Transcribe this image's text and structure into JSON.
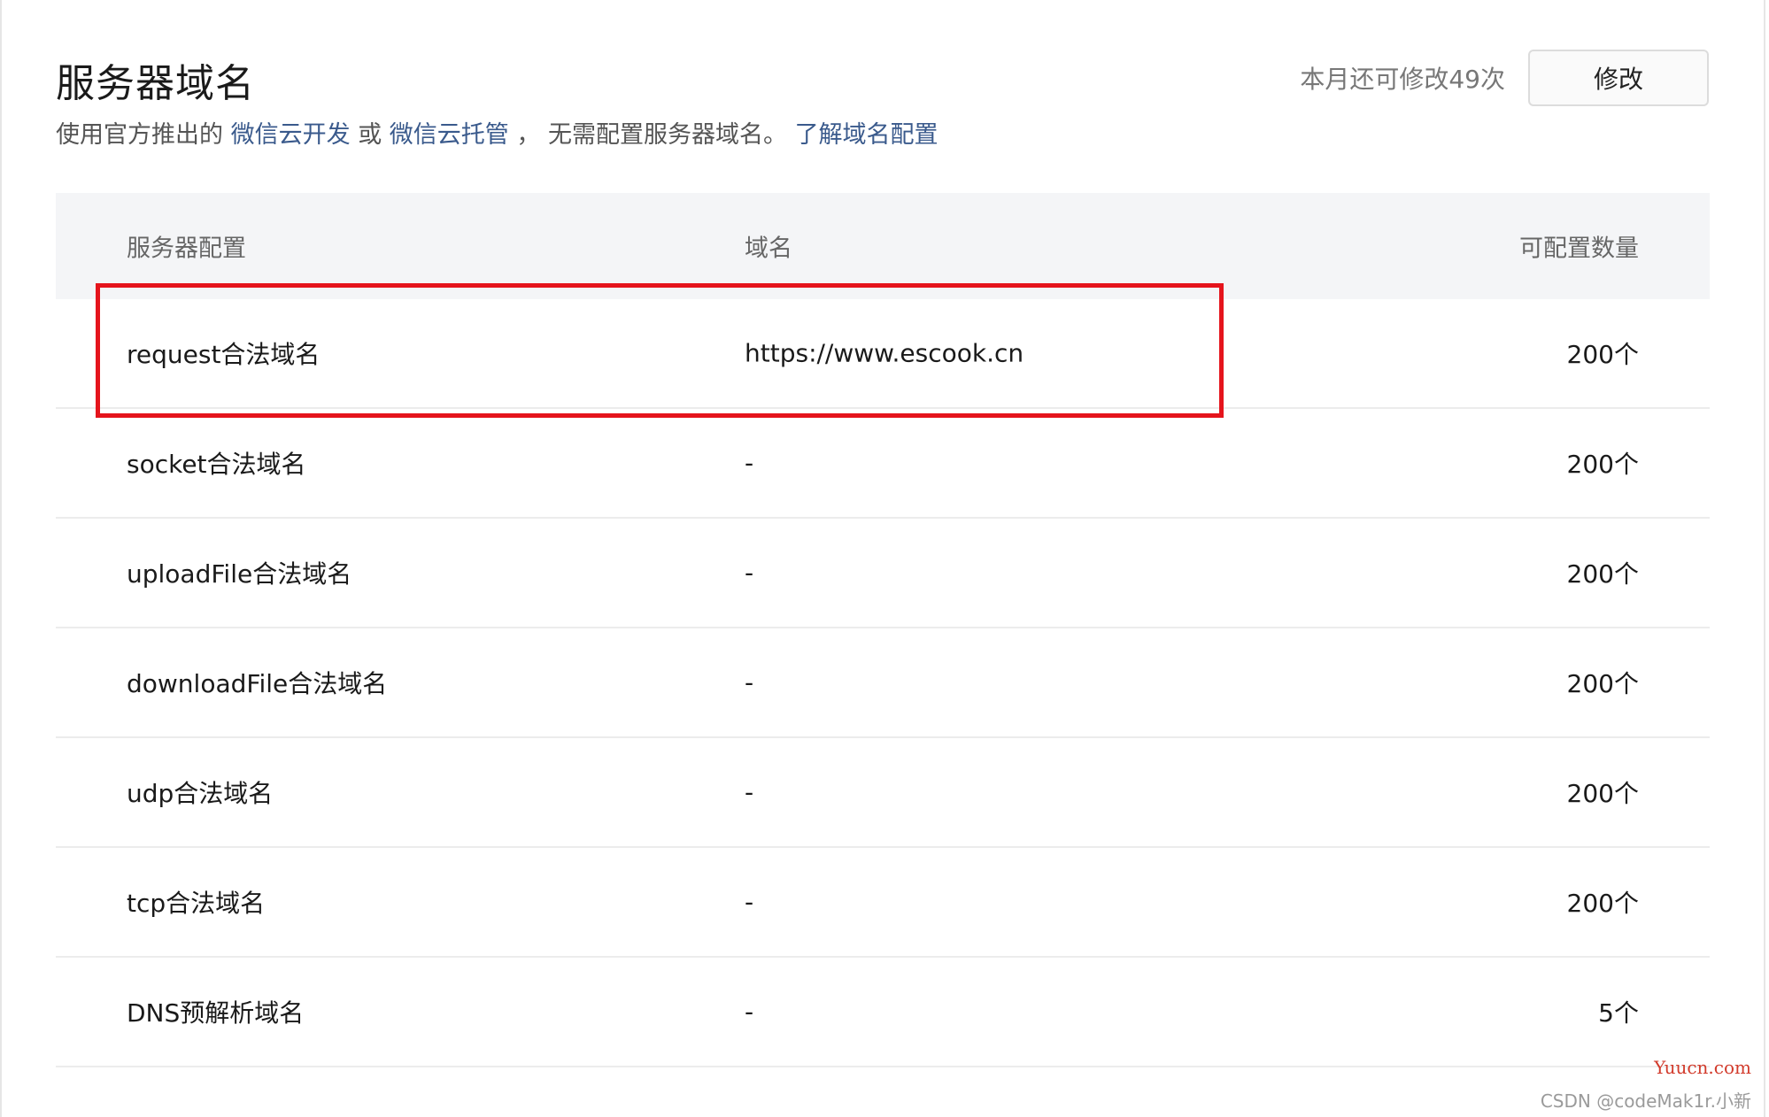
{
  "header": {
    "title": "服务器域名",
    "subtitle_prefix": "使用官方推出的",
    "link_cloud_dev": "微信云开发",
    "subtitle_or": "或",
    "link_cloud_hosting": "微信云托管",
    "subtitle_suffix": "， 无需配置服务器域名。",
    "link_learn": "了解域名配置",
    "quota_text": "本月还可修改49次",
    "edit_label": "修改"
  },
  "table": {
    "columns": [
      "服务器配置",
      "域名",
      "可配置数量"
    ],
    "rows": [
      {
        "type": "request合法域名",
        "domain": "https://www.escook.cn",
        "limit": "200个"
      },
      {
        "type": "socket合法域名",
        "domain": "-",
        "limit": "200个"
      },
      {
        "type": "uploadFile合法域名",
        "domain": "-",
        "limit": "200个"
      },
      {
        "type": "downloadFile合法域名",
        "domain": "-",
        "limit": "200个"
      },
      {
        "type": "udp合法域名",
        "domain": "-",
        "limit": "200个"
      },
      {
        "type": "tcp合法域名",
        "domain": "-",
        "limit": "200个"
      },
      {
        "type": "DNS预解析域名",
        "domain": "-",
        "limit": "5个"
      }
    ]
  },
  "annotation": {
    "color": "#e5141c"
  },
  "watermarks": {
    "site": "Yuucn.com",
    "author": "CSDN @codeMak1r.小新"
  },
  "colors": {
    "link": "#3a5a8c",
    "header_bg": "#f4f5f7"
  }
}
